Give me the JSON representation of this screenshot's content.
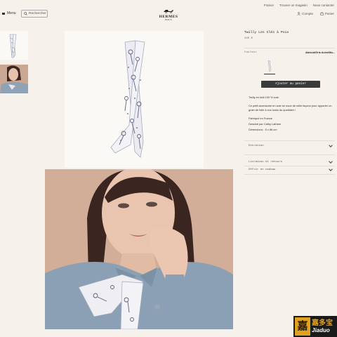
{
  "header": {
    "menu_label": "Menu",
    "search_placeholder": "Rechercher",
    "logo": {
      "brand": "HERMES",
      "city": "PARIS"
    },
    "top_links": [
      "France",
      "Trouver un magasin",
      "Nous contacter"
    ],
    "account_label": "Compte",
    "cart_label": "Panier"
  },
  "product": {
    "title": "Twilly Les Clés à Pois",
    "price": "245 €",
    "color_label": "Couleur",
    "color_value": "Abricot/Gris Acier/Mu...",
    "add_to_cart_label": "Ajouter au panier",
    "description": [
      "Twilly en twill 100 % soie.",
      "Ce petit accessoire en soie se noue de mille façons pour apporter un grain de folie à vos looks du quotidien !",
      "Fabriqué en France",
      "Dessiné par Cathy Latham",
      "Dimensions : 5 x 86 cm"
    ]
  },
  "accordions": [
    {
      "label": "Entretien"
    },
    {
      "label": "Livraison et retours"
    },
    {
      "label": "Offrir en cadeau"
    }
  ],
  "watermark": {
    "zh": "嘉多宝",
    "en": "Jiaduo"
  },
  "icons": {
    "menu": "hamburger-icon",
    "search": "search-icon",
    "account": "user-icon",
    "cart": "bag-icon"
  }
}
